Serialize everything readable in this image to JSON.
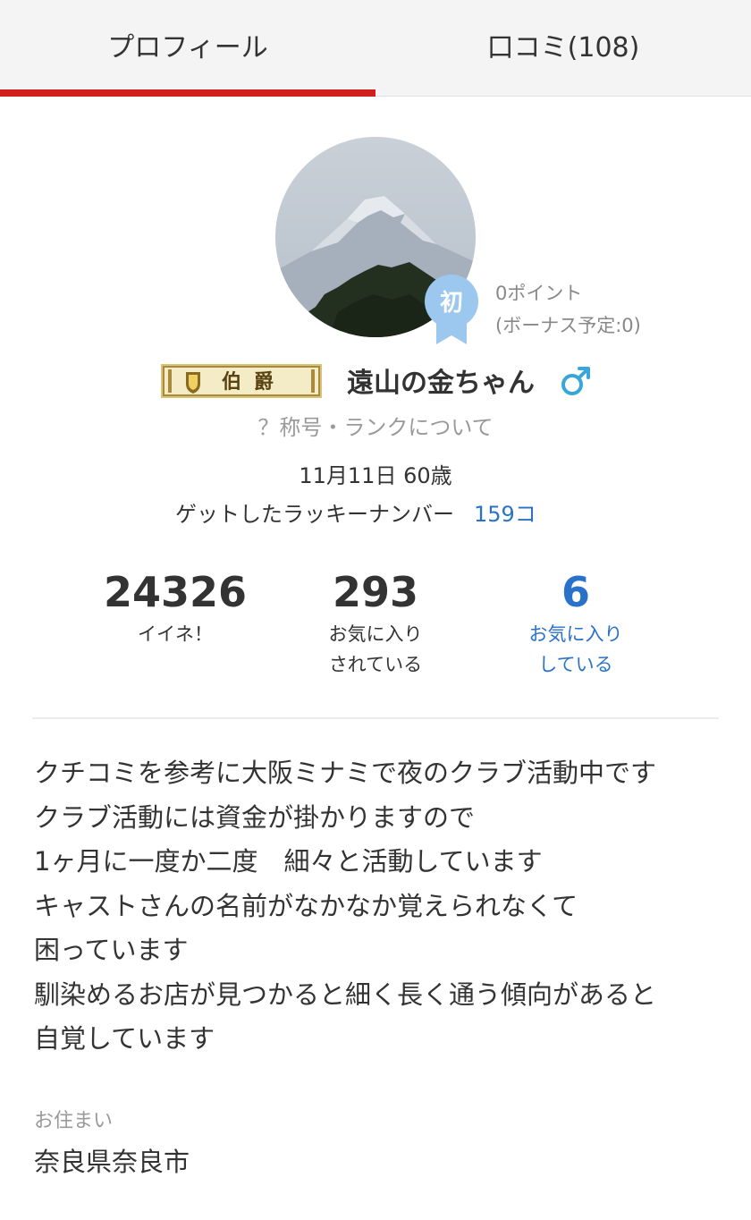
{
  "tabs": [
    {
      "label": "プロフィール",
      "active": true
    },
    {
      "label": "口コミ(108)",
      "active": false
    }
  ],
  "colors": {
    "accent": "#d0201e",
    "link": "#2a72c9",
    "badge": "#9cc8f0",
    "gender": "#3aa6d8"
  },
  "profile": {
    "badge_char": "初",
    "points": "0ポイント",
    "bonus": "(ボーナス予定:0)",
    "rank_title": "伯爵",
    "username": "遠山の金ちゃん",
    "gender_icon": "male-icon",
    "rank_link": "？称号・ランクについて",
    "birthday_age": "11月11日 60歳",
    "lucky_label": "ゲットしたラッキーナンバー",
    "lucky_count": "159コ"
  },
  "stats": [
    {
      "value": "24326",
      "label_line1": "イイネ！",
      "label_line2": ""
    },
    {
      "value": "293",
      "label_line1": "お気に入り",
      "label_line2": "されている"
    },
    {
      "value": "6",
      "label_line1": "お気に入り",
      "label_line2": "している"
    }
  ],
  "bio": [
    "クチコミを参考に大阪ミナミで夜のクラブ活動中です",
    "クラブ活動には資金が掛かりますので",
    "1ヶ月に一度か二度　細々と活動しています",
    "キャストさんの名前がなかなか覚えられなくて",
    "困っています",
    "馴染めるお店が見つかると細く長く通う傾向があると",
    "自覚しています"
  ],
  "residence": {
    "label": "お住まい",
    "value": "奈良県奈良市"
  }
}
